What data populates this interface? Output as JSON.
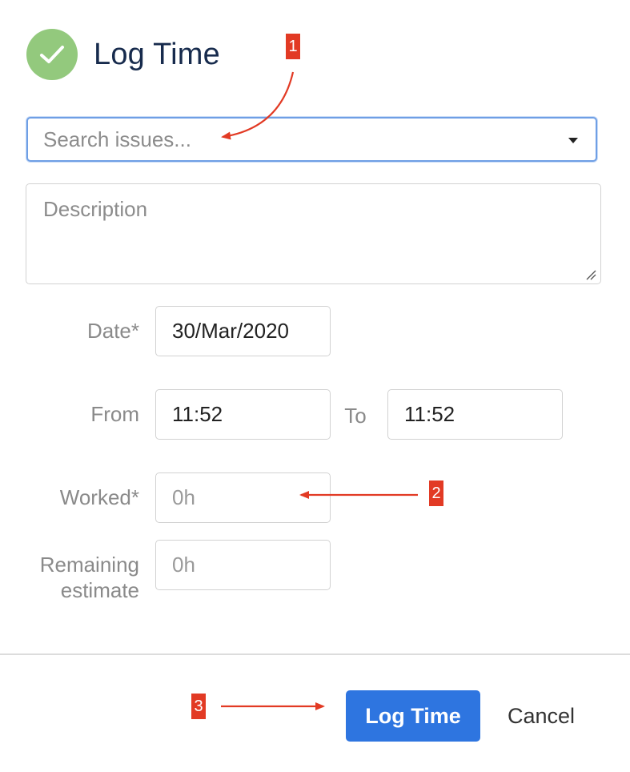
{
  "dialog": {
    "title": "Log Time"
  },
  "form": {
    "issue_search": {
      "placeholder": "Search issues...",
      "value": ""
    },
    "description": {
      "placeholder": "Description",
      "value": ""
    },
    "date": {
      "label": "Date*",
      "value": "30/Mar/2020"
    },
    "from": {
      "label": "From",
      "value": "11:52"
    },
    "to": {
      "label": "To",
      "value": "11:52"
    },
    "worked": {
      "label": "Worked*",
      "placeholder": "0h",
      "value": ""
    },
    "remaining": {
      "label_line1": "Remaining",
      "label_line2": "estimate",
      "placeholder": "0h",
      "value": ""
    }
  },
  "footer": {
    "submit_label": "Log Time",
    "cancel_label": "Cancel"
  },
  "annotations": {
    "badge_1": "1",
    "badge_2": "2",
    "badge_3": "3",
    "color": "#e23a24"
  },
  "colors": {
    "primary": "#2e75e0",
    "success_icon": "#93c97d",
    "title_text": "#172b4d",
    "focus_border": "#6f9fe5"
  }
}
